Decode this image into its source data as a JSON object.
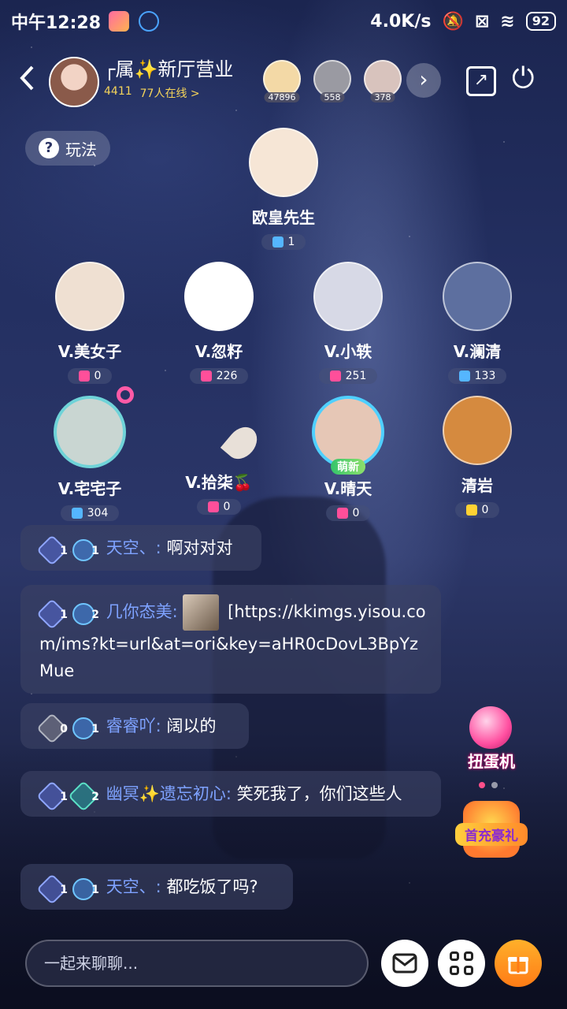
{
  "status_bar": {
    "time": "中午12:28",
    "network_speed": "4.0K/s",
    "battery": "92"
  },
  "header": {
    "title": "┌属✨新厅营业",
    "room_id": "4411",
    "online": "77人在线 >",
    "top_fans": [
      {
        "count": "47896",
        "color": "#f3d9a6"
      },
      {
        "count": "558",
        "color": "#9a9aa2"
      },
      {
        "count": "378",
        "color": "#d8c3bd"
      }
    ]
  },
  "rules_button": {
    "label": "玩法"
  },
  "host_seat": {
    "name": "欧皇先生",
    "gift": "1",
    "gem_color": "#55b6ff",
    "avatar_color": "#f6e6d6"
  },
  "seats": [
    {
      "name": "V.美女子",
      "gift": "0",
      "gem_color": "#ff4f9a",
      "avatar_color": "#efe0d2"
    },
    {
      "name": "V.忽籽",
      "gift": "226",
      "gem_color": "#ff4f9a",
      "avatar_color": "#ffffff"
    },
    {
      "name": "V.小轶",
      "gift": "251",
      "gem_color": "#ff4f9a",
      "avatar_color": "#d7d9e6"
    },
    {
      "name": "V.澜清",
      "gift": "133",
      "gem_color": "#55b6ff",
      "avatar_color": "#5d6f9f"
    },
    {
      "name": "V.宅宅子",
      "gift": "304",
      "gem_color": "#55b6ff",
      "avatar_color": "#c9d6d2"
    },
    {
      "name": "V.拾柒🍒",
      "gift": "0",
      "gem_color": "#ff4f9a",
      "avatar_color": ""
    },
    {
      "name": "V.晴天",
      "gift": "0",
      "gem_color": "#ff4f9a",
      "avatar_color": "#e6c7b6",
      "tag": "萌新"
    },
    {
      "name": "清岩",
      "gift": "0",
      "gem_color": "#ffd233",
      "avatar_color": "#d58a3f"
    }
  ],
  "messages": [
    {
      "badges": [
        "1",
        "1"
      ],
      "sender": "天空、:",
      "text": "啊对对对"
    },
    {
      "badges": [
        "1",
        "2"
      ],
      "sender": "几你态美:",
      "text": "[https://kkimgs.yisou.com/ims?kt=url&at=ori&key=aHR0cDovL3BpYzMue"
    },
    {
      "badges": [
        "0",
        "1"
      ],
      "sender": "睿睿吖:",
      "text": "阔以的"
    },
    {
      "badges": [
        "1",
        "2"
      ],
      "sender": "幽冥✨遗忘初心:",
      "text": "笑死我了，你们这些人"
    },
    {
      "badges": [
        "1",
        "1"
      ],
      "sender": "天空、:",
      "text": "都吃饭了吗?"
    }
  ],
  "side_banners": {
    "capsule_label": "扭蛋机",
    "first_pay_label": "首充豪礼"
  },
  "bottom_bar": {
    "input_placeholder": "一起来聊聊..."
  },
  "colors": {
    "accent_orange": "#ff8a1f",
    "sender_blue": "#7ea2ff",
    "online_yellow": "#f5d45a"
  }
}
